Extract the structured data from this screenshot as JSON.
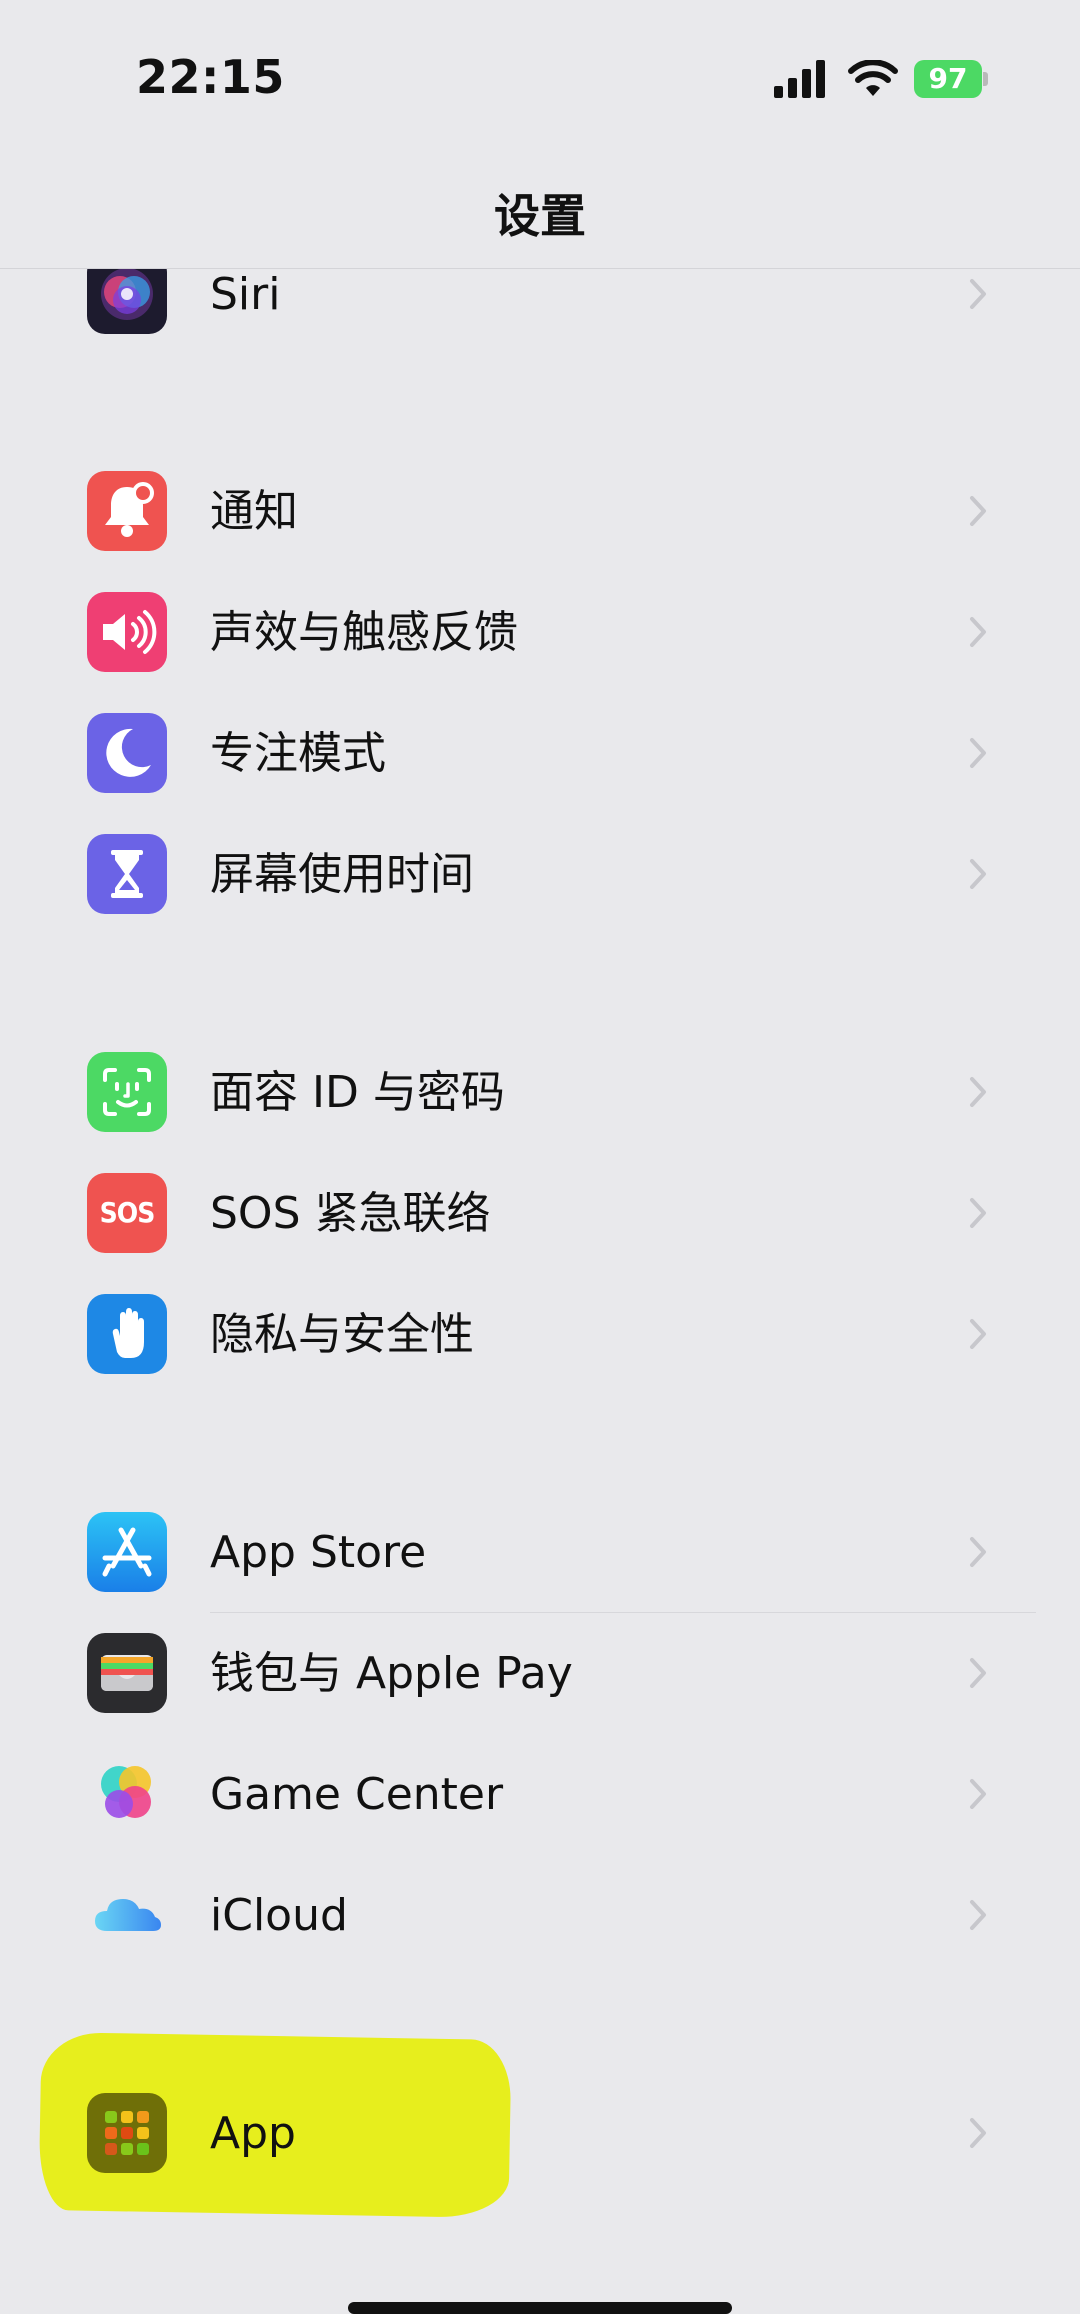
{
  "status_bar": {
    "time": "22:15",
    "battery": "97",
    "icons": [
      "signal-icon",
      "wifi-icon",
      "battery-icon"
    ]
  },
  "nav": {
    "title": "设置"
  },
  "rows": [
    {
      "label": "Siri",
      "icon": "siri-icon"
    },
    {
      "label": "通知",
      "icon": "bell-icon"
    },
    {
      "label": "声效与触感反馈",
      "icon": "speaker-icon"
    },
    {
      "label": "专注模式",
      "icon": "moon-icon"
    },
    {
      "label": "屏幕使用时间",
      "icon": "hourglass-icon"
    },
    {
      "label": "面容 ID 与密码",
      "icon": "face-id-icon"
    },
    {
      "label": "SOS 紧急联络",
      "icon": "sos-icon",
      "icon_text": "SOS"
    },
    {
      "label": "隐私与安全性",
      "icon": "hand-icon"
    },
    {
      "label": "App Store",
      "icon": "app-store-icon"
    },
    {
      "label": "钱包与 Apple Pay",
      "icon": "wallet-icon"
    },
    {
      "label": "Game Center",
      "icon": "game-center-icon"
    },
    {
      "label": "iCloud",
      "icon": "icloud-icon"
    },
    {
      "label": "App",
      "icon": "apps-grid-icon"
    }
  ],
  "colors": {
    "background": "#e9e9ec",
    "bell": "#ef5350",
    "sound": "#ef3f73",
    "focus": "#6b63e6",
    "screen_time": "#6b63e6",
    "face_id": "#4cd964",
    "sos": "#ef5350",
    "privacy": "#1e88e5",
    "app_store": "#1f9bf0",
    "wallet": "#2b2b2e",
    "highlight": "#e7ee12"
  }
}
